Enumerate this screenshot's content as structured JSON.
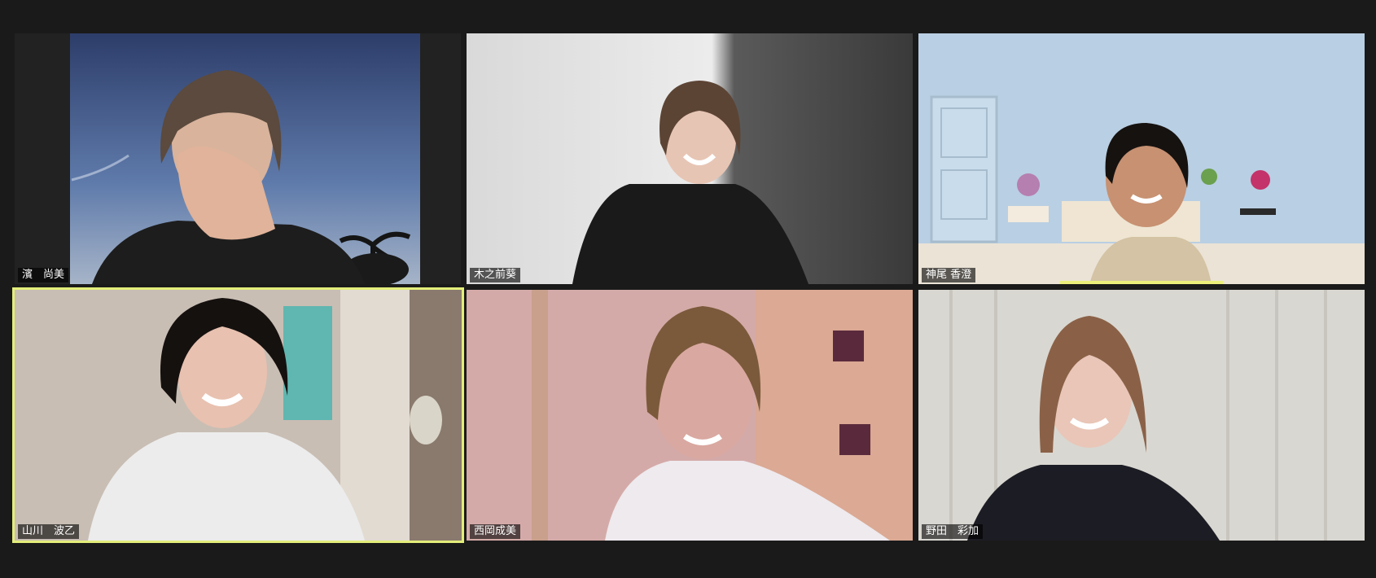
{
  "window": {
    "background": "#1a1a1a"
  },
  "participants": [
    {
      "name": "濱　尚美",
      "video": "outdoor-sky-background",
      "active_speaker": false
    },
    {
      "name": "木之前葵",
      "video": "grey-room-background",
      "active_speaker": false
    },
    {
      "name": "神尾 香澄",
      "video": "virtual-room-background-with-door",
      "active_speaker": false,
      "speaking_indicator": true
    },
    {
      "name": "山川　波乙",
      "video": "kitchen-background",
      "active_speaker": true
    },
    {
      "name": "西岡成美",
      "video": "pink-room-background",
      "active_speaker": false
    },
    {
      "name": "野田　彩加",
      "video": "curtain-background",
      "active_speaker": false
    }
  ],
  "colors": {
    "active_speaker_border": "#e3ee7a",
    "speaking_indicator": "#ecf07a",
    "name_tag_bg": "rgba(0,0,0,0.62)"
  }
}
